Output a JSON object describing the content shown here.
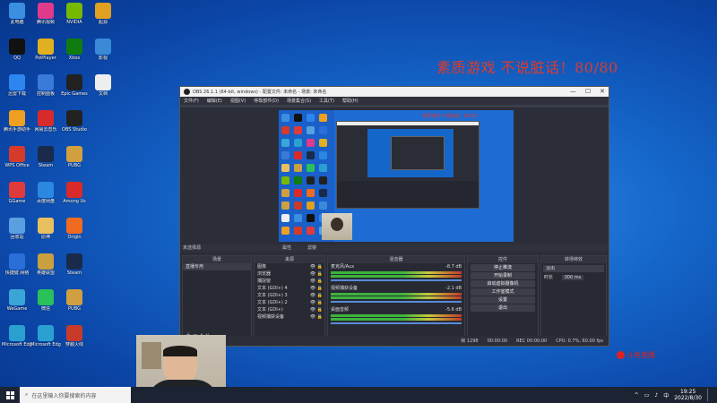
{
  "banner": {
    "text": "素质游戏 不说脏话！80/80"
  },
  "desktop": {
    "icons": [
      {
        "label": "此电脑",
        "color": "#3b8fe0"
      },
      {
        "label": "QQ",
        "color": "#111"
      },
      {
        "label": "迅雷下载",
        "color": "#2d86f0"
      },
      {
        "label": "腾讯手游助手",
        "color": "#f0a020"
      },
      {
        "label": "WPS Office",
        "color": "#d63a2a"
      },
      {
        "label": "GGame",
        "color": "#e03a3a"
      },
      {
        "label": "回收站",
        "color": "#5aa0e0"
      },
      {
        "label": "快捷键 网络",
        "color": "#2a6fd8"
      },
      {
        "label": "WeGame",
        "color": "#3aa6d8"
      },
      {
        "label": "Microsoft Edge",
        "color": "#2aa0d0"
      },
      {
        "label": "腾讯视频",
        "color": "#e03a8a"
      },
      {
        "label": "PotPlayer",
        "color": "#e0b020"
      },
      {
        "label": "控制面板",
        "color": "#3a7ad8"
      },
      {
        "label": "网易云音乐",
        "color": "#d82a2a"
      },
      {
        "label": "Steam",
        "color": "#1a2a4a"
      },
      {
        "label": "百度网盘",
        "color": "#2a88e0"
      },
      {
        "label": "原神",
        "color": "#e8c060"
      },
      {
        "label": "英雄联盟",
        "color": "#c8a040"
      },
      {
        "label": "微信",
        "color": "#2ac05a"
      },
      {
        "label": "Microsoft Edge",
        "color": "#2aa0d0"
      },
      {
        "label": "NVIDIA",
        "color": "#76b900"
      },
      {
        "label": "Xbox",
        "color": "#107c10"
      },
      {
        "label": "Epic Games",
        "color": "#222"
      },
      {
        "label": "OBS Studio",
        "color": "#222"
      },
      {
        "label": "PUBG",
        "color": "#d0a040"
      },
      {
        "label": "Among Us",
        "color": "#d82a2a"
      },
      {
        "label": "Origin",
        "color": "#f06a20"
      },
      {
        "label": "Steam",
        "color": "#1a2a4a"
      },
      {
        "label": "PUBG",
        "color": "#d0a040"
      },
      {
        "label": "穿越火线",
        "color": "#c83a2a"
      },
      {
        "label": "起源",
        "color": "#e0a020"
      },
      {
        "label": "影视",
        "color": "#3a8ad8"
      },
      {
        "label": "文档",
        "color": "#eee"
      }
    ]
  },
  "obs": {
    "title": "OBS 26.1.1 (64-bit, windows) - 配置文件: 未命名 - 场景: 未命名",
    "menu": [
      "文件(F)",
      "编辑(E)",
      "视图(V)",
      "停靠部件(D)",
      "场景集合(S)",
      "工具(T)",
      "帮助(H)"
    ],
    "no_source": "未选择源",
    "properties": "属性",
    "filters": "滤镜",
    "scenes": {
      "title": "场景",
      "items": [
        "直播专用"
      ]
    },
    "sources": {
      "title": "来源",
      "items": [
        "图像",
        "浏览器",
        "捕捉窗",
        "文本 (GDI+) 4",
        "文本 (GDI+) 3",
        "文本 (GDI+) 2",
        "文本 (GDI+)",
        "视频捕获设备"
      ]
    },
    "mixer": {
      "title": "混音器",
      "tracks": [
        {
          "name": "麦克风/Aux",
          "db": "-8.7 dB"
        },
        {
          "name": "视频捕获设备",
          "db": "-2.1 dB"
        },
        {
          "name": "桌面音频",
          "db": "-5.6 dB"
        }
      ]
    },
    "controls": {
      "title": "控件",
      "buttons": [
        "停止推流",
        "开始录制",
        "启动虚拟摄像机",
        "工作室模式",
        "设置",
        "退出"
      ]
    },
    "transitions": {
      "title": "转场特效",
      "type": "淡出",
      "duration_label": "时长",
      "duration": "300 ms"
    },
    "status": [
      "帧 1298",
      "00:00:00",
      "REC 00:00:00",
      "CPU: 0.7%, 60.00 fps"
    ],
    "preview_text": "素质游戏 不说脏话！80/80"
  },
  "taskbar": {
    "search_placeholder": "在这里输入你要搜索的内容",
    "time": "19:25",
    "date": "2022/8/30"
  },
  "watermark": {
    "text": "斗鱼直播"
  },
  "colors": {
    "accent": "#e23a2a",
    "desktop": "#1566c9",
    "obs_bg": "#2b2e38"
  }
}
